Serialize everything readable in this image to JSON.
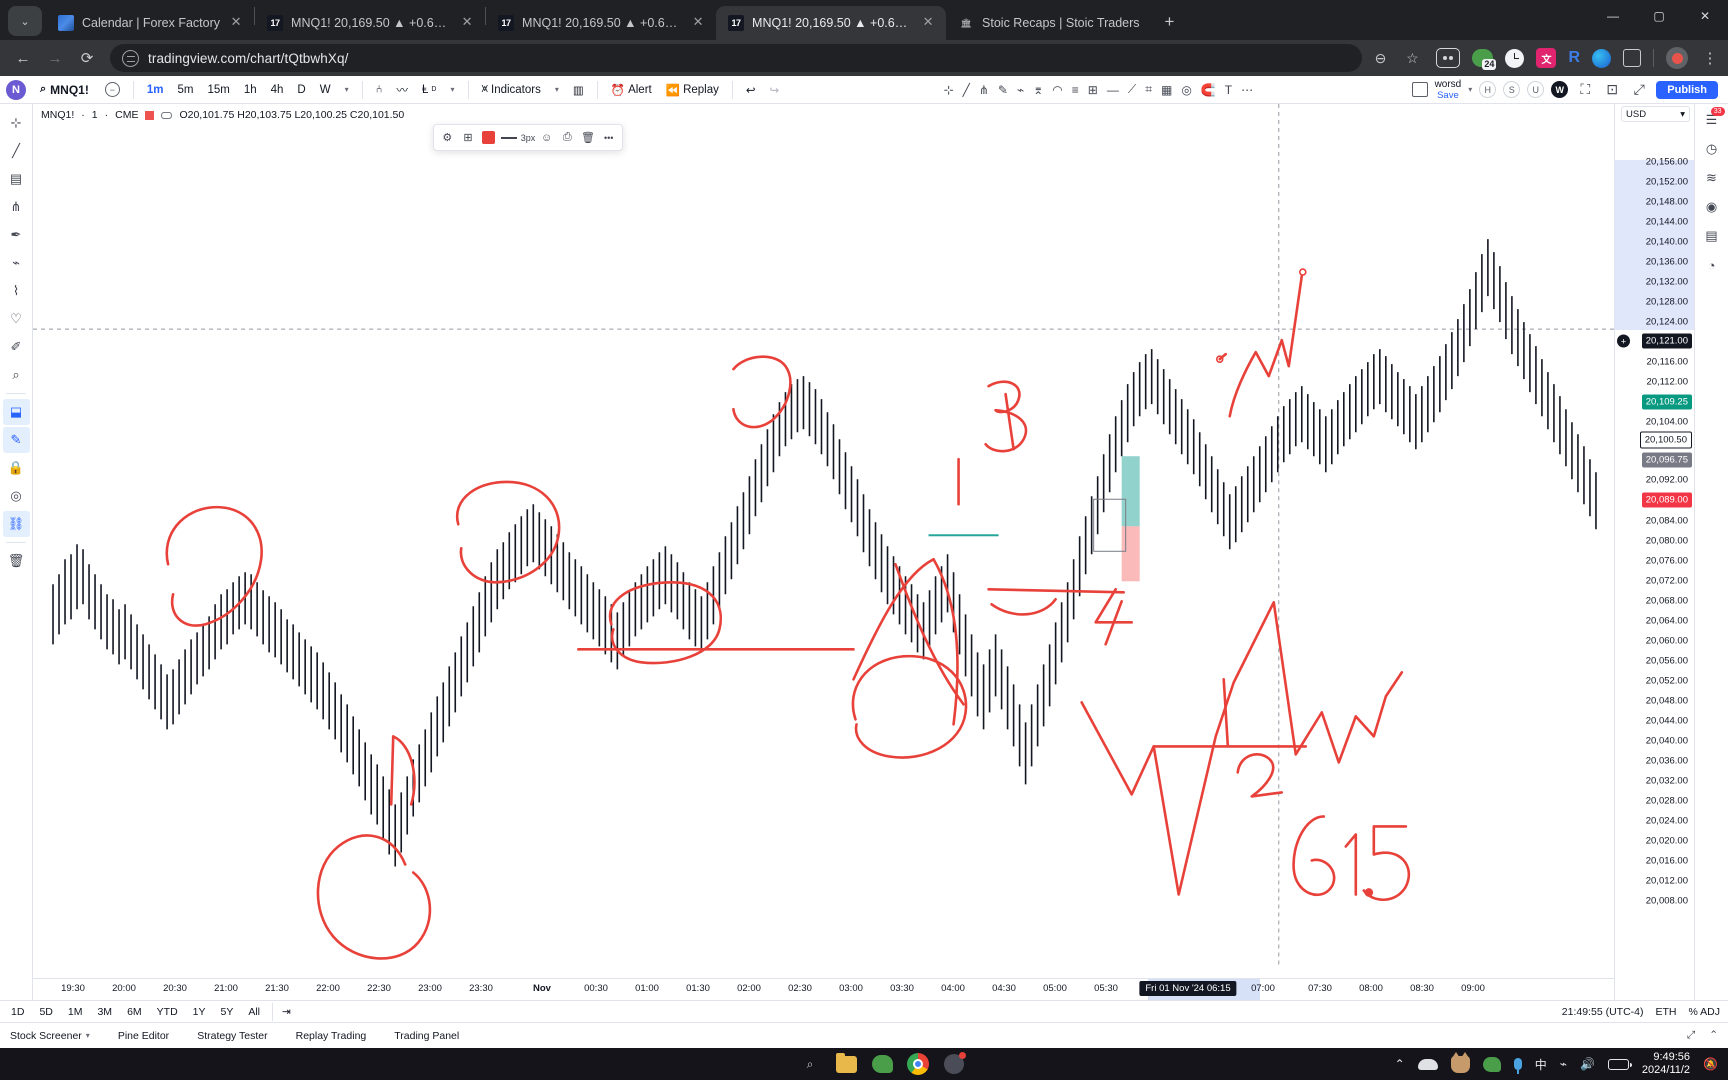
{
  "browser": {
    "tabs": [
      {
        "title": "Calendar | Forex Factory",
        "favicon": "forexfactory-icon",
        "active": false
      },
      {
        "title": "MNQ1! 20,169.50 ▲ +0.67%",
        "favicon": "tradingview-icon",
        "active": false
      },
      {
        "title": "MNQ1! 20,169.50 ▲ +0.67%",
        "favicon": "tradingview-icon",
        "active": false
      },
      {
        "title": "MNQ1! 20,169.50 ▲ +0.67%",
        "favicon": "tradingview-icon",
        "active": true
      },
      {
        "title": "Stoic Recaps | Stoic Traders",
        "favicon": "stoic-icon",
        "active": false
      }
    ],
    "new_tab_label": "+",
    "url": "tradingview.com/chart/tQtbwhXq/",
    "nav": {
      "back": "←",
      "forward": "→",
      "reload": "⟳"
    },
    "omnibox_icon": "site-settings-icon",
    "window_controls": {
      "minimize": "—",
      "maximize": "▢",
      "close": "✕"
    },
    "extensions": [
      {
        "name": "zoom-out-icon",
        "glyph": "⌕"
      },
      {
        "name": "bookmark-star-icon",
        "glyph": "☆"
      },
      {
        "name": "notebook-extension-icon",
        "glyph": "oo"
      },
      {
        "name": "wechat-extension-icon",
        "badge": "24"
      },
      {
        "name": "clock-extension-icon"
      },
      {
        "name": "translate-extension-icon",
        "glyph": "文A"
      },
      {
        "name": "r-extension-icon",
        "glyph": "R"
      },
      {
        "name": "edge-extension-icon"
      },
      {
        "name": "puzzle-extensions-icon"
      },
      {
        "name": "profile-avatar"
      },
      {
        "name": "chrome-menu-icon",
        "glyph": "⋮"
      }
    ]
  },
  "tradingview": {
    "logo": "N",
    "symbol_search": "MNQ1!",
    "search_icon": "magnifier-icon",
    "compare_icon": "compare-minus-icon",
    "intervals": [
      "1m",
      "5m",
      "15m",
      "1h",
      "4h",
      "D",
      "W"
    ],
    "interval_active": "1m",
    "interval_more": "▾",
    "chart_type_icons": [
      "candles-icon",
      "line-icon",
      "bar-with-d-icon"
    ],
    "indicators_label": "Indicators",
    "indicators_icon": "indicators-icon",
    "templates_icon": "grid-templates-icon",
    "alert_label": "Alert",
    "alert_icon": "alarm-clock-icon",
    "replay_label": "Replay",
    "replay_icon": "replay-icon",
    "undo_icon": "undo-arrow-icon",
    "redo_icon": "redo-arrow-icon",
    "drawing_tools_icons": [
      "crosshair-icon",
      "trend-line-icon",
      "pitchfork-icon",
      "brush-icon",
      "text-icon",
      "pattern-icon",
      "arc-icon",
      "fib-icon",
      "long-position-icon",
      "ruler-icon",
      "horizontal-line-icon",
      "gann-icon",
      "table-icon",
      "location-icon",
      "magnet-icon",
      "measure-icon",
      "more-tools-icon"
    ],
    "layout": {
      "name": "worsd",
      "save_label": "Save",
      "caret": "▾"
    },
    "layout_icon": "layout-square-icon",
    "right_badges": [
      "H",
      "S",
      "U",
      "W"
    ],
    "publish_label": "Publish",
    "legend": {
      "symbol": "MNQ1!",
      "interval": "1",
      "exchange": "CME",
      "ohlc": "O20,101.75  H20,103.75  L20,100.25  C20,101.50",
      "color_square": "#ef5350",
      "eye_icon": "visibility-icon"
    },
    "draw_toolbar": {
      "tools": [
        "settings-icon",
        "text-style-icon",
        "color-swatch",
        "line-width-line",
        "3px",
        "emoji-icon",
        "template-icon",
        "trash-icon",
        "more-icon"
      ],
      "line_width_label": "3px",
      "more_label": "•••",
      "swatch_color": "#e8413a"
    },
    "left_rail_tools": [
      "cursor-cross-icon",
      "trend-line-icon",
      "fib-retracement-icon",
      "pitchfork-icon",
      "brush-icon",
      "text-tool-icon",
      "pattern-icon",
      "emoji-icon",
      "measure-icon",
      "zoom-tool-icon",
      "magnet-mode-icon",
      "drawing-mode-icon",
      "lock-drawings-icon",
      "hide-drawings-icon",
      "object-tree-icon",
      "remove-drawings-icon"
    ],
    "right_rail_tools": [
      "watchlist-icon",
      "alerts-icon",
      "hotlist-icon",
      "calendar-icon",
      "data-window-icon",
      "chat-icon",
      "ideas-icon",
      "notes-icon",
      "settings-gear-icon"
    ],
    "right_rail_badge": "33",
    "price_axis": {
      "currency": "USD",
      "currency_caret": "▾",
      "ticks": [
        "20,156.00",
        "20,152.00",
        "20,148.00",
        "20,144.00",
        "20,140.00",
        "20,136.00",
        "20,132.00",
        "20,128.00",
        "20,124.00",
        "20,116.00",
        "20,112.00",
        "20,104.00",
        "20,092.00",
        "20,084.00",
        "20,080.00",
        "20,076.00",
        "20,072.00",
        "20,068.00",
        "20,064.00",
        "20,060.00",
        "20,056.00",
        "20,052.00",
        "20,048.00",
        "20,044.00",
        "20,040.00",
        "20,036.00",
        "20,032.00",
        "20,028.00",
        "20,024.00",
        "20,020.00",
        "20,016.00",
        "20,012.00",
        "20,008.00"
      ],
      "crosshair_price": "20,121.00",
      "last_price": "20,109.25",
      "bid_price": "20,100.50",
      "ask_price": "20,096.75",
      "prev_close": "20,089.00",
      "add_alert_icon": "plus-circle-icon"
    },
    "time_axis": {
      "ticks": [
        "19:30",
        "20:00",
        "20:30",
        "21:00",
        "21:30",
        "22:00",
        "22:30",
        "23:00",
        "23:30",
        "Nov",
        "00:30",
        "01:00",
        "01:30",
        "02:00",
        "02:30",
        "03:00",
        "03:30",
        "04:00",
        "04:30",
        "05:00",
        "05:30",
        "07:00",
        "07:30",
        "08:00",
        "08:30",
        "09:00"
      ],
      "crosshair_label": "Fri 01 Nov '24  06:15"
    },
    "bottom_bar": {
      "ranges": [
        "1D",
        "5D",
        "1M",
        "3M",
        "6M",
        "YTD",
        "1Y",
        "5Y",
        "All"
      ],
      "settings_icon": "date-range-icon",
      "clock": "21:49:55 (UTC-4)",
      "session": "ETH",
      "adjust": "%  ADJ",
      "log_icon": "log-scale-icon",
      "auto_icon": "auto-fit-icon"
    },
    "panels": {
      "items": [
        "Stock Screener",
        "Pine Editor",
        "Strategy Tester",
        "Replay Trading",
        "Trading Panel"
      ],
      "screener_caret": "▾",
      "right_icons": [
        "fullscreen-icon",
        "collapse-icon"
      ]
    }
  },
  "chart_data": {
    "type": "candlestick",
    "title": "MNQ1! · 1 · CME",
    "symbol": "MNQ1!",
    "interval": "1",
    "exchange": "CME",
    "xlabel": "",
    "ylabel": "USD",
    "ylim": [
      20006,
      20158
    ],
    "xlim": [
      "19:30",
      "09:00"
    ],
    "grid": false,
    "ohlc_last": {
      "open": "20,101.75",
      "high": "20,103.75",
      "low": "20,100.25",
      "close": "20,101.50"
    },
    "price_levels": {
      "crosshair": 20121.0,
      "last": 20109.25,
      "bid": 20100.5,
      "ask": 20096.75,
      "prev_close": 20089.0
    },
    "annotations": [
      {
        "type": "freehand-circle",
        "label": "circle-left-consolidation"
      },
      {
        "type": "freehand-circle",
        "label": "circle-pullback-22h"
      },
      {
        "type": "freehand-circle",
        "label": "circle-top-0130"
      },
      {
        "type": "freehand-circle",
        "label": "circle-midrange-2300"
      },
      {
        "type": "freehand-circle",
        "label": "circle-0400-lows"
      },
      {
        "type": "text",
        "label": "3"
      },
      {
        "type": "text",
        "label": "4"
      },
      {
        "type": "text",
        "label": "1"
      },
      {
        "type": "text",
        "label": "2"
      },
      {
        "type": "text",
        "label": "61.5"
      },
      {
        "type": "horizontal-line",
        "label": "support-line-2300"
      },
      {
        "type": "horizontal-line",
        "label": "level-line-0500"
      },
      {
        "type": "sketch",
        "label": "projection-zigzag-up"
      },
      {
        "type": "sketch",
        "label": "projection-pattern-bottom"
      }
    ]
  },
  "taskbar": {
    "apps": [
      "windows-start-icon",
      "search-icon",
      "file-explorer-icon",
      "wechat-icon",
      "chrome-icon",
      "app-ball-icon"
    ],
    "tray": [
      "chevron-up-icon",
      "cloud-icon",
      "cat-icon",
      "wechat-tray-icon",
      "mic-icon",
      "ime-icon",
      "wifi-icon",
      "volume-icon",
      "battery-icon"
    ],
    "ime_label": "中",
    "clock_time": "9:49:56",
    "clock_date": "2024/11/2",
    "notification_icon": "bell-mute-icon"
  }
}
